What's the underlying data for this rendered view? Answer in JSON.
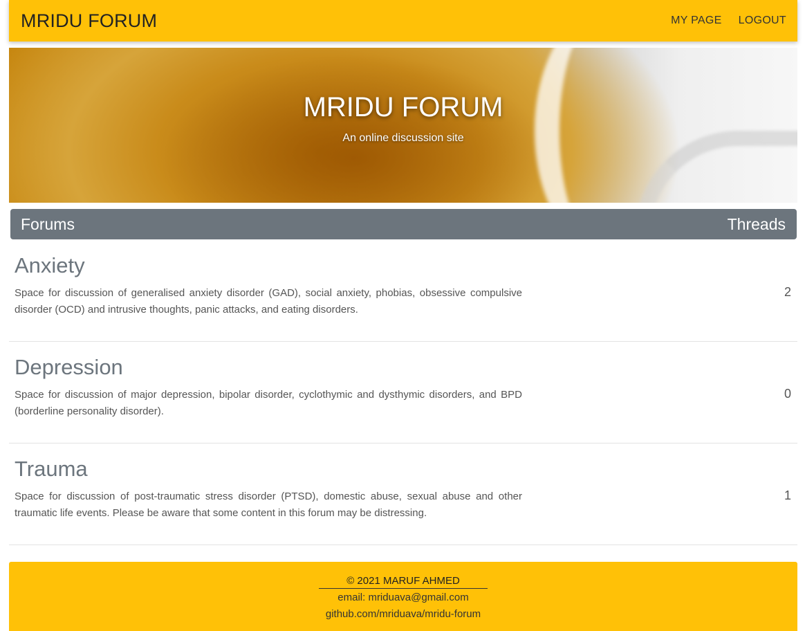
{
  "navbar": {
    "brand": "MRIDU FORUM",
    "links": [
      "MY PAGE",
      "LOGOUT"
    ]
  },
  "hero": {
    "title": "MRIDU FORUM",
    "subtitle": "An online discussion site"
  },
  "forums_header": {
    "left": "Forums",
    "right": "Threads"
  },
  "forums": [
    {
      "title": "Anxiety",
      "description": "Space for discussion of generalised anxiety disorder (GAD), social anxiety, phobias, obsessive compulsive disorder (OCD) and intrusive thoughts, panic attacks, and eating disorders.",
      "threads": "2"
    },
    {
      "title": "Depression",
      "description": "Space for discussion of major depression, bipolar disorder, cyclothymic and dysthymic disorders, and BPD (borderline personality disorder).",
      "threads": "0"
    },
    {
      "title": "Trauma",
      "description": "Space for discussion of post-traumatic stress disorder (PTSD), domestic abuse, sexual abuse and other traumatic life events. Please be aware that some content in this forum may be distressing.",
      "threads": "1"
    }
  ],
  "footer": {
    "copyright": "© 2021 MARUF AHMED",
    "email": "email: mriduava@gmail.com",
    "github": "github.com/mriduava/mridu-forum"
  },
  "colors": {
    "accent": "#ffc107",
    "header_gray": "#6c757d"
  }
}
